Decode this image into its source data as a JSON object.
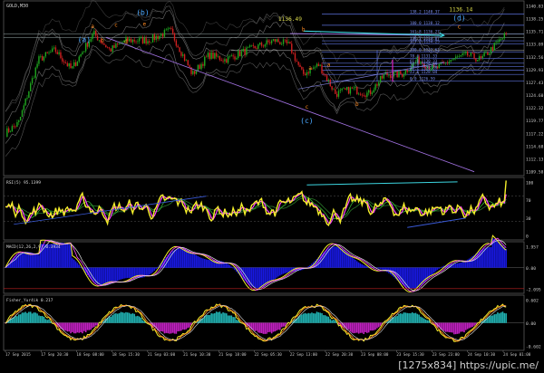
{
  "chart_data": [
    {
      "type": "line",
      "panel": "price",
      "symbol_label": "GOLD,M30",
      "ylim": [
        1107.2,
        1143.1
      ],
      "y_ticks": [
        "1140.83",
        "1138.25",
        "1135.71",
        "1133.09",
        "1132.56",
        "1129.93",
        "1127.43",
        "1124.60",
        "1122.32",
        "1119.77",
        "1117.22",
        "1114.68",
        "1112.13",
        "1109.58"
      ],
      "annotations": [
        "1136.49",
        "1136.14"
      ],
      "wave_labels": [
        "(a)",
        "a",
        "b",
        "c",
        "(b)",
        "d",
        "e",
        "a",
        "b",
        "c",
        "(c)",
        "a",
        "b",
        "c",
        "(d)"
      ],
      "fib_levels": [
        {
          "label": "138.2 1140.37",
          "value": 1140.4
        },
        {
          "label": "100.0 1138.12",
          "value": 1138.1
        },
        {
          "label": "161.8 1136.27",
          "value": 1136.3
        },
        {
          "label": "138.2 1134.87",
          "value": 1134.9
        },
        {
          "label": "127.2 1134.25",
          "value": 1134.3
        },
        {
          "label": "100.0 1132.62",
          "value": 1132.6
        },
        {
          "label": "78.6 1131.33",
          "value": 1131.3
        },
        {
          "label": "61.8 1130.33",
          "value": 1130.3
        },
        {
          "label": "50.0 1129.59",
          "value": 1129.6
        },
        {
          "label": "38.2 1128.89",
          "value": 1128.9
        },
        {
          "label": "23.6 1128.04",
          "value": 1128.0
        },
        {
          "label": "0.0 1126.59",
          "value": 1126.6
        }
      ]
    },
    {
      "type": "line",
      "panel": "rsi",
      "title": "RSI(5) 95.1399",
      "ylim": [
        0,
        100
      ],
      "y_ticks": [
        "100",
        "70",
        "30",
        "0"
      ]
    },
    {
      "type": "area",
      "panel": "macd",
      "title": "MACD(12,26,2,9) 0.3934",
      "y_ticks": [
        "1.957",
        "0.00",
        "-2.095"
      ]
    },
    {
      "type": "line",
      "panel": "fisher",
      "title": "Fisher_Yur4ik 0.217",
      "y_ticks": [
        "0.602",
        "0.00",
        "-0.602"
      ]
    }
  ],
  "x_ticks": [
    "17 Sep 2015",
    "17 Sep 20:30",
    "18 Sep 08:00",
    "18 Sep 15:30",
    "21 Sep 03:00",
    "21 Sep 10:30",
    "21 Sep 18:00",
    "22 Sep 05:30",
    "22 Sep 13:00",
    "22 Sep 20:30",
    "23 Sep 08:00",
    "23 Sep 15:30",
    "23 Sep 23:00",
    "24 Sep 10:30",
    "24 Sep 01:00"
  ],
  "watermark": "[1275x834] https://upic.me/",
  "colors": {
    "bg": "#000000",
    "bull": "#1fa51f",
    "bear": "#d02020",
    "grid": "#303030",
    "axis": "#707070",
    "rsi_line": "#f5ef2a",
    "rsi_signal": "#ff44ff",
    "green_band": "#33b233",
    "trend_cyan": "#3cd5e0",
    "macd_hist": "#1818e0",
    "macd_main": "#e0e0e0",
    "fisher_hist_pos": "#20b0b0",
    "fisher_hist_neg": "#c020c0",
    "wave_orange": "#ff8a22",
    "wave_blue": "#4aa8ff",
    "gold_text": "#d8d84a",
    "channel": "#a070e0"
  }
}
